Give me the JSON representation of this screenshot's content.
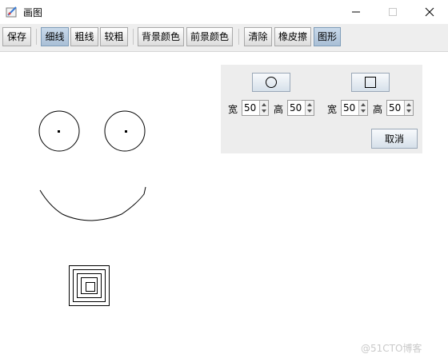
{
  "window": {
    "title": "画图",
    "icon": "paint-app-icon",
    "controls": [
      "minimize-icon",
      "maximize-icon",
      "close-icon"
    ]
  },
  "toolbar": {
    "save_label": "保存",
    "thin_label": "细线",
    "thick_label": "粗线",
    "thicker_label": "较粗",
    "bg_color_label": "背景颜色",
    "fg_color_label": "前景颜色",
    "clear_label": "清除",
    "eraser_label": "橡皮擦",
    "shape_label": "图形"
  },
  "shape_panel": {
    "circle": {
      "icon": "circle-icon",
      "width_label": "宽",
      "width_value": "50",
      "height_label": "高",
      "height_value": "50"
    },
    "square": {
      "icon": "square-icon",
      "width_label": "宽",
      "width_value": "50",
      "height_label": "高",
      "height_value": "50"
    },
    "cancel_label": "取消"
  },
  "watermark": "@51CTO博客"
}
